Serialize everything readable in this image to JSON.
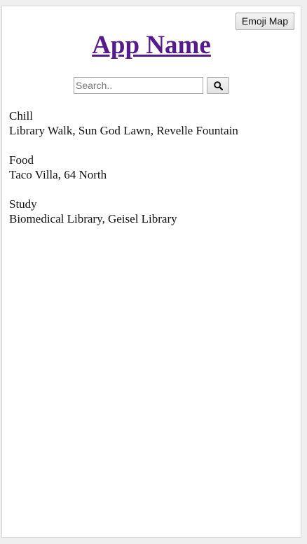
{
  "header": {
    "emoji_map_button": "Emoji Map",
    "title": "App Name"
  },
  "search": {
    "placeholder": "Search..",
    "value": "",
    "button_icon": "search-icon"
  },
  "categories": [
    {
      "name": "Chill",
      "places": "Library Walk, Sun God Lawn, Revelle Fountain"
    },
    {
      "name": "Food",
      "places": "Taco Villa, 64 North"
    },
    {
      "name": "Study",
      "places": "Biomedical Library, Geisel Library"
    }
  ],
  "colors": {
    "title_link": "#551a8b",
    "page_background": "#ffffff",
    "outer_background": "#efefef"
  }
}
